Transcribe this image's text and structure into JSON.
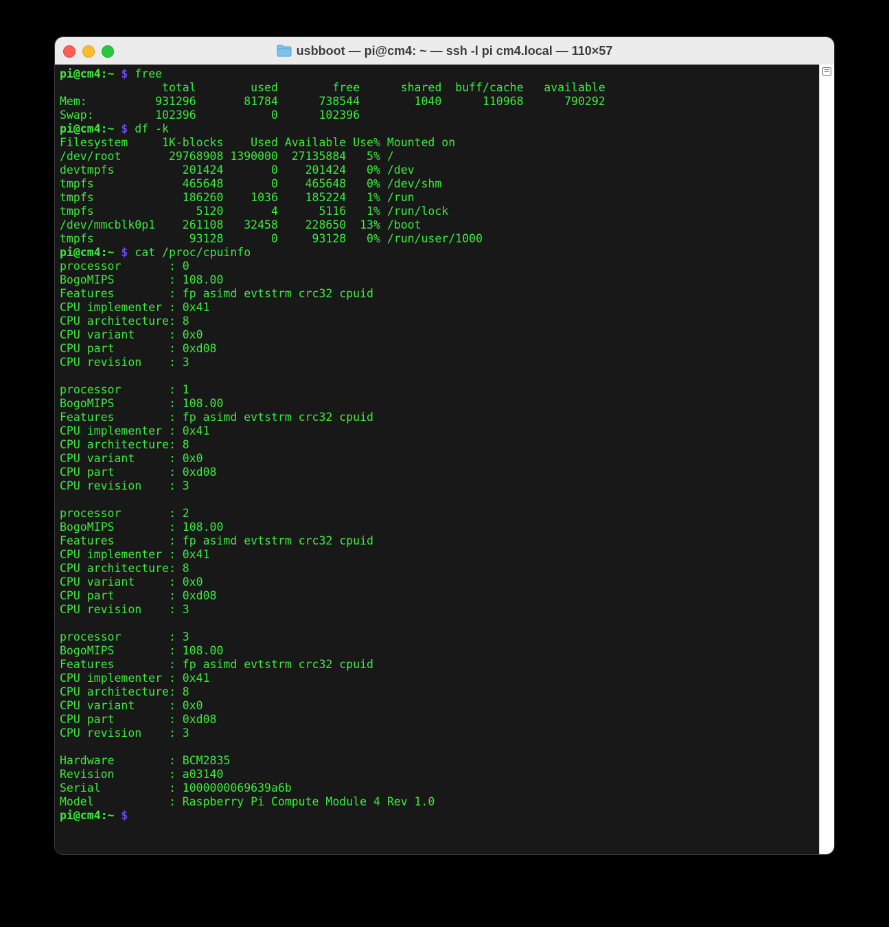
{
  "window": {
    "title": "usbboot — pi@cm4: ~ — ssh -l pi cm4.local — 110×57"
  },
  "terminal": {
    "prompt_user": "pi@cm4",
    "prompt_path": ":~",
    "prompt_symbol": "$",
    "lines": [
      {
        "type": "prompt",
        "cmd": " free"
      },
      {
        "type": "out",
        "text": "               total        used        free      shared  buff/cache   available"
      },
      {
        "type": "out",
        "text": "Mem:          931296       81784      738544        1040      110968      790292"
      },
      {
        "type": "out",
        "text": "Swap:         102396           0      102396"
      },
      {
        "type": "prompt",
        "cmd": " df -k"
      },
      {
        "type": "out",
        "text": "Filesystem     1K-blocks    Used Available Use% Mounted on"
      },
      {
        "type": "out",
        "text": "/dev/root       29768908 1390000  27135884   5% /"
      },
      {
        "type": "out",
        "text": "devtmpfs          201424       0    201424   0% /dev"
      },
      {
        "type": "out",
        "text": "tmpfs             465648       0    465648   0% /dev/shm"
      },
      {
        "type": "out",
        "text": "tmpfs             186260    1036    185224   1% /run"
      },
      {
        "type": "out",
        "text": "tmpfs               5120       4      5116   1% /run/lock"
      },
      {
        "type": "out",
        "text": "/dev/mmcblk0p1    261108   32458    228650  13% /boot"
      },
      {
        "type": "out",
        "text": "tmpfs              93128       0     93128   0% /run/user/1000"
      },
      {
        "type": "prompt",
        "cmd": " cat /proc/cpuinfo"
      },
      {
        "type": "out",
        "text": "processor       : 0"
      },
      {
        "type": "out",
        "text": "BogoMIPS        : 108.00"
      },
      {
        "type": "out",
        "text": "Features        : fp asimd evtstrm crc32 cpuid"
      },
      {
        "type": "out",
        "text": "CPU implementer : 0x41"
      },
      {
        "type": "out",
        "text": "CPU architecture: 8"
      },
      {
        "type": "out",
        "text": "CPU variant     : 0x0"
      },
      {
        "type": "out",
        "text": "CPU part        : 0xd08"
      },
      {
        "type": "out",
        "text": "CPU revision    : 3"
      },
      {
        "type": "out",
        "text": ""
      },
      {
        "type": "out",
        "text": "processor       : 1"
      },
      {
        "type": "out",
        "text": "BogoMIPS        : 108.00"
      },
      {
        "type": "out",
        "text": "Features        : fp asimd evtstrm crc32 cpuid"
      },
      {
        "type": "out",
        "text": "CPU implementer : 0x41"
      },
      {
        "type": "out",
        "text": "CPU architecture: 8"
      },
      {
        "type": "out",
        "text": "CPU variant     : 0x0"
      },
      {
        "type": "out",
        "text": "CPU part        : 0xd08"
      },
      {
        "type": "out",
        "text": "CPU revision    : 3"
      },
      {
        "type": "out",
        "text": ""
      },
      {
        "type": "out",
        "text": "processor       : 2"
      },
      {
        "type": "out",
        "text": "BogoMIPS        : 108.00"
      },
      {
        "type": "out",
        "text": "Features        : fp asimd evtstrm crc32 cpuid"
      },
      {
        "type": "out",
        "text": "CPU implementer : 0x41"
      },
      {
        "type": "out",
        "text": "CPU architecture: 8"
      },
      {
        "type": "out",
        "text": "CPU variant     : 0x0"
      },
      {
        "type": "out",
        "text": "CPU part        : 0xd08"
      },
      {
        "type": "out",
        "text": "CPU revision    : 3"
      },
      {
        "type": "out",
        "text": ""
      },
      {
        "type": "out",
        "text": "processor       : 3"
      },
      {
        "type": "out",
        "text": "BogoMIPS        : 108.00"
      },
      {
        "type": "out",
        "text": "Features        : fp asimd evtstrm crc32 cpuid"
      },
      {
        "type": "out",
        "text": "CPU implementer : 0x41"
      },
      {
        "type": "out",
        "text": "CPU architecture: 8"
      },
      {
        "type": "out",
        "text": "CPU variant     : 0x0"
      },
      {
        "type": "out",
        "text": "CPU part        : 0xd08"
      },
      {
        "type": "out",
        "text": "CPU revision    : 3"
      },
      {
        "type": "out",
        "text": ""
      },
      {
        "type": "out",
        "text": "Hardware        : BCM2835"
      },
      {
        "type": "out",
        "text": "Revision        : a03140"
      },
      {
        "type": "out",
        "text": "Serial          : 1000000069639a6b"
      },
      {
        "type": "out",
        "text": "Model           : Raspberry Pi Compute Module 4 Rev 1.0"
      },
      {
        "type": "prompt_active",
        "cmd": ""
      }
    ]
  },
  "colors": {
    "terminal_bg": "#181818",
    "text_green": "#3bea3b",
    "prompt_symbol": "#6a4be8"
  },
  "icons": {
    "title_icon": "folder-icon",
    "scrollbar_icon": "scrollback-marks-icon"
  }
}
